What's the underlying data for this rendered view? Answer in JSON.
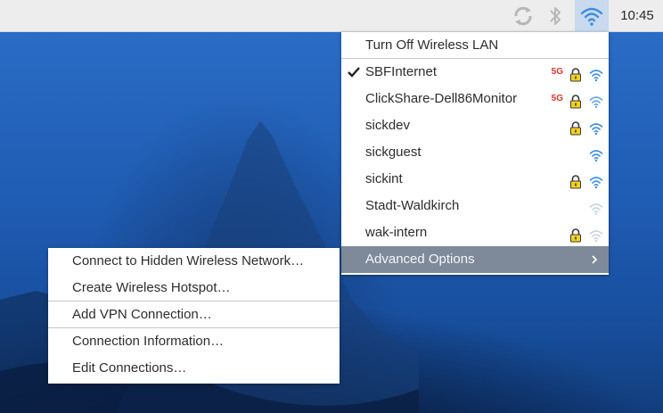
{
  "taskbar": {
    "clock": "10:45",
    "icons": [
      "sync-icon",
      "bluetooth-icon",
      "wifi-icon"
    ]
  },
  "wifi_menu": {
    "toggle_label": "Turn Off Wireless LAN",
    "networks": [
      {
        "ssid": "SBFInternet",
        "connected": true,
        "band": "5G",
        "secured": true,
        "signal": "strong"
      },
      {
        "ssid": "ClickShare-Dell86Monitor",
        "connected": false,
        "band": "5G",
        "secured": true,
        "signal": "medium"
      },
      {
        "ssid": "sickdev",
        "connected": false,
        "band": "",
        "secured": true,
        "signal": "strong"
      },
      {
        "ssid": "sickguest",
        "connected": false,
        "band": "",
        "secured": false,
        "signal": "strong"
      },
      {
        "ssid": "sickint",
        "connected": false,
        "band": "",
        "secured": true,
        "signal": "strong"
      },
      {
        "ssid": "Stadt-Waldkirch",
        "connected": false,
        "band": "",
        "secured": false,
        "signal": "weak"
      },
      {
        "ssid": "wak-intern",
        "connected": false,
        "band": "",
        "secured": true,
        "signal": "weak"
      }
    ],
    "advanced_label": "Advanced Options"
  },
  "advanced_menu": {
    "items": [
      "Connect to Hidden Wireless Network…",
      "Create Wireless Hotspot…",
      "Add VPN Connection…",
      "Connection Information…",
      "Edit Connections…"
    ]
  },
  "colors": {
    "accent_blue": "#3a8ee6",
    "badge_red": "#e23232",
    "lock_yellow": "#f2d21b",
    "highlight": "#7e8a99"
  }
}
